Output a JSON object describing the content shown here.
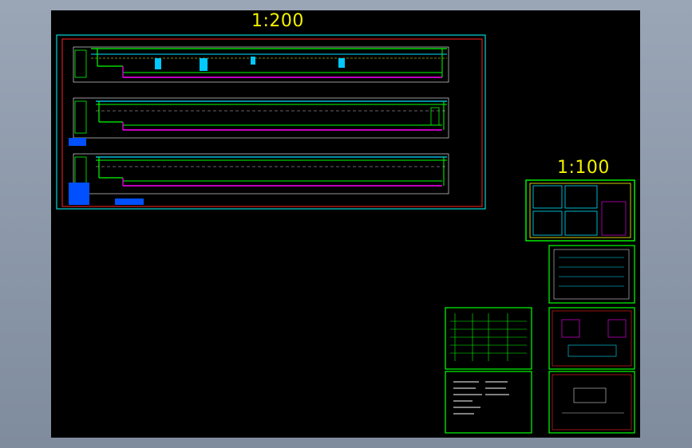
{
  "viewport": {
    "background": "#8c97a8",
    "canvas": "#000000"
  },
  "labels": {
    "scale_large": "1:200",
    "scale_small": "1:100"
  },
  "colors": {
    "frame_outer": "#00ffff",
    "frame_inner": "#ff2020",
    "sheet_border": "#00ff00",
    "line_main": "#00ff00",
    "line_cyan": "#00e0ff",
    "line_magenta": "#ff00ff",
    "line_white": "#ffffff",
    "line_yellow": "#ffff00",
    "text_scale": "#f2f200"
  },
  "icons": {
    "sheet": "drawing-sheet-icon"
  }
}
